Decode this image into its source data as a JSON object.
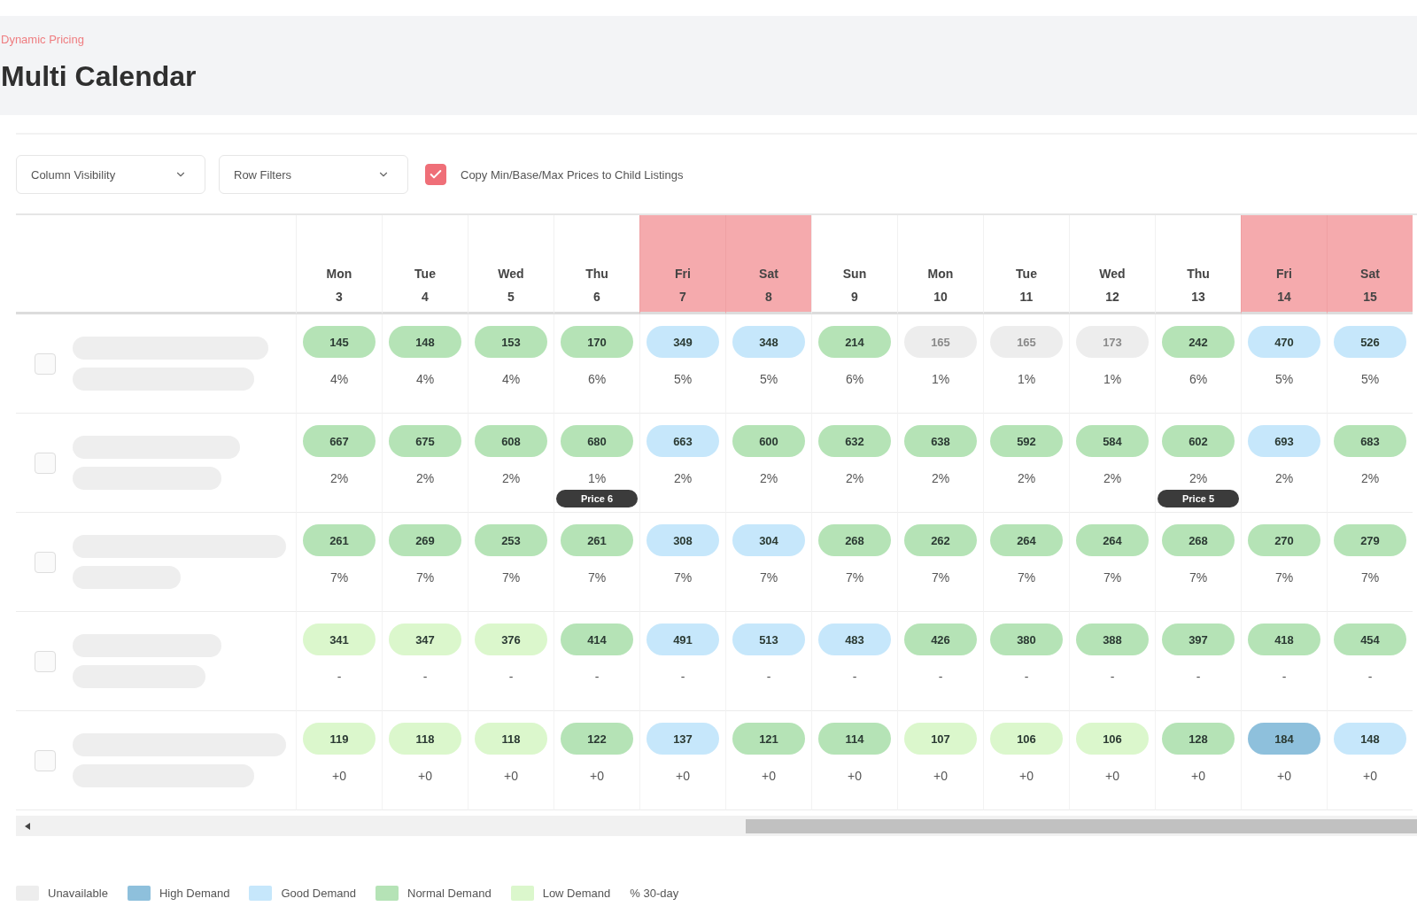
{
  "header": {
    "breadcrumb": "Dynamic Pricing",
    "title": "Multi Calendar"
  },
  "toolbar": {
    "dropdowns": [
      "Column Visibility",
      "Row Filters"
    ],
    "copy_prices": {
      "label": "Copy Min/Base/Max Prices to Child Listings",
      "checked": true
    }
  },
  "calendar": {
    "days": [
      {
        "weekday": "Mon",
        "date": "3",
        "weekend": false
      },
      {
        "weekday": "Tue",
        "date": "4",
        "weekend": false
      },
      {
        "weekday": "Wed",
        "date": "5",
        "weekend": false
      },
      {
        "weekday": "Thu",
        "date": "6",
        "weekend": false
      },
      {
        "weekday": "Fri",
        "date": "7",
        "weekend": true
      },
      {
        "weekday": "Sat",
        "date": "8",
        "weekend": true
      },
      {
        "weekday": "Sun",
        "date": "9",
        "weekend": false
      },
      {
        "weekday": "Mon",
        "date": "10",
        "weekend": false
      },
      {
        "weekday": "Tue",
        "date": "11",
        "weekend": false
      },
      {
        "weekday": "Wed",
        "date": "12",
        "weekend": false
      },
      {
        "weekday": "Thu",
        "date": "13",
        "weekend": false
      },
      {
        "weekday": "Fri",
        "date": "14",
        "weekend": true
      },
      {
        "weekday": "Sat",
        "date": "15",
        "weekend": true
      }
    ],
    "rows": [
      {
        "checked": false,
        "cells": [
          {
            "price": "145",
            "color": "#b5e3b6",
            "note": "4%"
          },
          {
            "price": "148",
            "color": "#b5e3b6",
            "note": "4%"
          },
          {
            "price": "153",
            "color": "#b5e3b6",
            "note": "4%"
          },
          {
            "price": "170",
            "color": "#b5e3b6",
            "note": "6%"
          },
          {
            "price": "349",
            "color": "#c6e7fb",
            "note": "5%"
          },
          {
            "price": "348",
            "color": "#c6e7fb",
            "note": "5%"
          },
          {
            "price": "214",
            "color": "#b5e3b6",
            "note": "6%"
          },
          {
            "price": "165",
            "color": "#ededed",
            "note": "1%"
          },
          {
            "price": "165",
            "color": "#ededed",
            "note": "1%"
          },
          {
            "price": "173",
            "color": "#ededed",
            "note": "1%"
          },
          {
            "price": "242",
            "color": "#b5e3b6",
            "note": "6%"
          },
          {
            "price": "470",
            "color": "#c6e7fb",
            "note": "5%"
          },
          {
            "price": "526",
            "color": "#c6e7fb",
            "note": "5%"
          }
        ]
      },
      {
        "checked": false,
        "cells": [
          {
            "price": "667",
            "color": "#b5e3b6",
            "note": "2%"
          },
          {
            "price": "675",
            "color": "#b5e3b6",
            "note": "2%"
          },
          {
            "price": "608",
            "color": "#b5e3b6",
            "note": "2%"
          },
          {
            "price": "680",
            "color": "#b5e3b6",
            "note": "1%",
            "badge": "Price 6"
          },
          {
            "price": "663",
            "color": "#c6e7fb",
            "note": "2%"
          },
          {
            "price": "600",
            "color": "#b5e3b6",
            "note": "2%"
          },
          {
            "price": "632",
            "color": "#b5e3b6",
            "note": "2%"
          },
          {
            "price": "638",
            "color": "#b5e3b6",
            "note": "2%"
          },
          {
            "price": "592",
            "color": "#b5e3b6",
            "note": "2%"
          },
          {
            "price": "584",
            "color": "#b5e3b6",
            "note": "2%"
          },
          {
            "price": "602",
            "color": "#b5e3b6",
            "note": "2%",
            "badge": "Price 5"
          },
          {
            "price": "693",
            "color": "#c6e7fb",
            "note": "2%"
          },
          {
            "price": "683",
            "color": "#b5e3b6",
            "note": "2%"
          }
        ]
      },
      {
        "checked": false,
        "cells": [
          {
            "price": "261",
            "color": "#b5e3b6",
            "note": "7%"
          },
          {
            "price": "269",
            "color": "#b5e3b6",
            "note": "7%"
          },
          {
            "price": "253",
            "color": "#b5e3b6",
            "note": "7%"
          },
          {
            "price": "261",
            "color": "#b5e3b6",
            "note": "7%"
          },
          {
            "price": "308",
            "color": "#c6e7fb",
            "note": "7%"
          },
          {
            "price": "304",
            "color": "#c6e7fb",
            "note": "7%"
          },
          {
            "price": "268",
            "color": "#b5e3b6",
            "note": "7%"
          },
          {
            "price": "262",
            "color": "#b5e3b6",
            "note": "7%"
          },
          {
            "price": "264",
            "color": "#b5e3b6",
            "note": "7%"
          },
          {
            "price": "264",
            "color": "#b5e3b6",
            "note": "7%"
          },
          {
            "price": "268",
            "color": "#b5e3b6",
            "note": "7%"
          },
          {
            "price": "270",
            "color": "#b5e3b6",
            "note": "7%"
          },
          {
            "price": "279",
            "color": "#b5e3b6",
            "note": "7%"
          }
        ]
      },
      {
        "checked": false,
        "cells": [
          {
            "price": "341",
            "color": "#dbf7cc",
            "note": "-"
          },
          {
            "price": "347",
            "color": "#dbf7cc",
            "note": "-"
          },
          {
            "price": "376",
            "color": "#dbf7cc",
            "note": "-"
          },
          {
            "price": "414",
            "color": "#b5e3b6",
            "note": "-"
          },
          {
            "price": "491",
            "color": "#c6e7fb",
            "note": "-"
          },
          {
            "price": "513",
            "color": "#c6e7fb",
            "note": "-"
          },
          {
            "price": "483",
            "color": "#c6e7fb",
            "note": "-"
          },
          {
            "price": "426",
            "color": "#b5e3b6",
            "note": "-"
          },
          {
            "price": "380",
            "color": "#b5e3b6",
            "note": "-"
          },
          {
            "price": "388",
            "color": "#b5e3b6",
            "note": "-"
          },
          {
            "price": "397",
            "color": "#b5e3b6",
            "note": "-"
          },
          {
            "price": "418",
            "color": "#b5e3b6",
            "note": "-"
          },
          {
            "price": "454",
            "color": "#b5e3b6",
            "note": "-"
          }
        ]
      },
      {
        "checked": false,
        "cells": [
          {
            "price": "119",
            "color": "#dbf7cc",
            "note": "+0"
          },
          {
            "price": "118",
            "color": "#dbf7cc",
            "note": "+0"
          },
          {
            "price": "118",
            "color": "#dbf7cc",
            "note": "+0"
          },
          {
            "price": "122",
            "color": "#b5e3b6",
            "note": "+0"
          },
          {
            "price": "137",
            "color": "#c6e7fb",
            "note": "+0"
          },
          {
            "price": "121",
            "color": "#b5e3b6",
            "note": "+0"
          },
          {
            "price": "114",
            "color": "#b5e3b6",
            "note": "+0"
          },
          {
            "price": "107",
            "color": "#dbf7cc",
            "note": "+0"
          },
          {
            "price": "106",
            "color": "#dbf7cc",
            "note": "+0"
          },
          {
            "price": "106",
            "color": "#dbf7cc",
            "note": "+0"
          },
          {
            "price": "128",
            "color": "#b5e3b6",
            "note": "+0"
          },
          {
            "price": "184",
            "color": "#8ec0dc",
            "note": "+0"
          },
          {
            "price": "148",
            "color": "#c6e7fb",
            "note": "+0"
          }
        ]
      }
    ]
  },
  "legend": [
    {
      "kind": "swatch",
      "label": "Unavailable",
      "color": "#ededed"
    },
    {
      "kind": "swatch",
      "label": "High Demand",
      "color": "#8ec0dc"
    },
    {
      "kind": "swatch",
      "label": "Good Demand",
      "color": "#c6e7fb"
    },
    {
      "kind": "swatch",
      "label": "Normal Demand",
      "color": "#b5e3b6"
    },
    {
      "kind": "swatch",
      "label": "Low Demand",
      "color": "#dbf7cc"
    },
    {
      "kind": "text",
      "label": "% 30-day"
    }
  ]
}
